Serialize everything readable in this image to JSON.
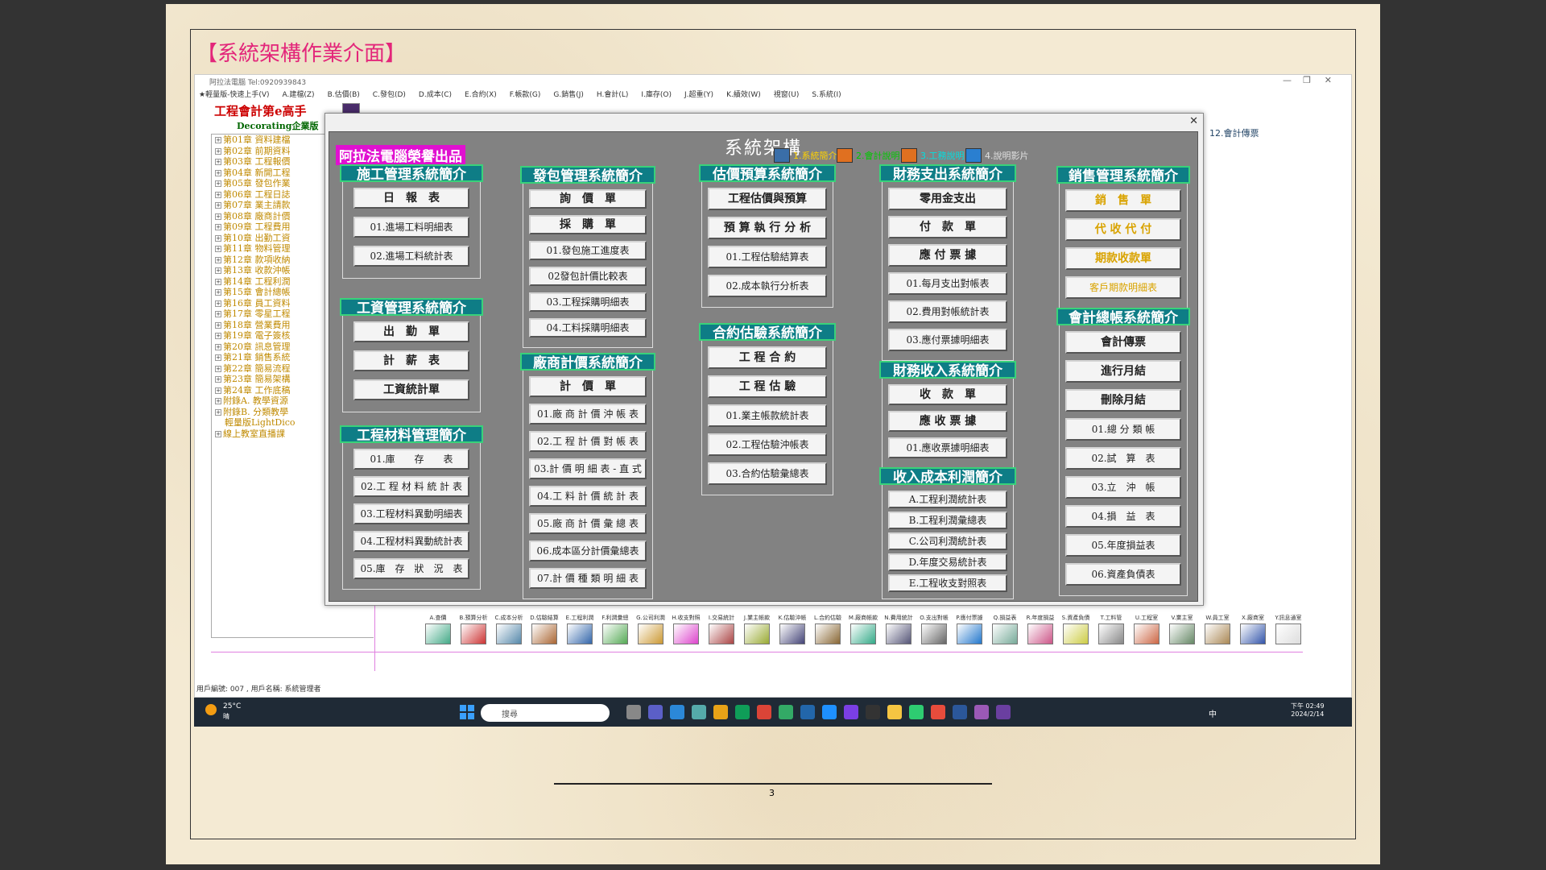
{
  "doc_title": "【系統架構作業介面】",
  "page_number": "3",
  "window": {
    "title": "阿拉法電腦 Tel:0920939843"
  },
  "menu": [
    "★輕量版-快速上手(V)",
    "A.建檔(Z)",
    "B.估價(B)",
    "C.發包(D)",
    "D.成本(C)",
    "E.合約(X)",
    "F.帳款(G)",
    "G.銷售(J)",
    "H.會計(L)",
    "I.庫存(O)",
    "J.超重(Y)",
    "K.績效(W)",
    "視窗(U)",
    "S.系統(I)"
  ],
  "brand": {
    "line1": "工程會計第e高手",
    "line2": "Decorating企業版"
  },
  "right_label": "12.會計傳票",
  "tree": [
    "第01章 資料建檔",
    "第02章 前期資料",
    "第03章 工程報價",
    "第04章 新開工程",
    "第05章 發包作業",
    "第06章 工程日誌",
    "第07章 業主請款",
    "第08章 廠商計價",
    "第09章 工程費用",
    "第10章 出勤工資",
    "第11章 物料管理",
    "第12章 款項收納",
    "第13章 收款沖帳",
    "第14章 工程利潤",
    "第15章 會計總帳",
    "第16章 員工資料",
    "第17章 零星工程",
    "第18章 營業費用",
    "第19章 電子簽核",
    "第20章 訊息管理",
    "第21章 銷售系統",
    "第22章 簡易流程",
    "第23章 簡易架構",
    "第24章 工作底稿",
    "附錄A. 教學資源",
    "附錄B. 分類教學",
    "輕量版LightDico",
    "線上教室直播課"
  ],
  "status": "用戶編號: 007 , 用戶名稱: 系統管理者",
  "dialog": {
    "title": "系統架構",
    "credit": "阿拉法電腦榮譽出品",
    "links": [
      {
        "label": "1.系統簡介",
        "color": "#ffd200"
      },
      {
        "label": "2.會計說明",
        "color": "#00c800"
      },
      {
        "label": "3.工務說明",
        "color": "#00e0e0"
      },
      {
        "label": "4.說明影片",
        "color": "#e0e0e0"
      }
    ],
    "groups": [
      {
        "title": "施工管理系統簡介",
        "buttons": [
          "日　報　表",
          "01.進場工料明細表",
          "02.進場工料統計表"
        ]
      },
      {
        "title": "工資管理系統簡介",
        "buttons": [
          "出　勤　單",
          "計　薪　表",
          "工資統計單"
        ]
      },
      {
        "title": "工程材料管理簡介",
        "buttons": [
          "01.庫　　存　　表",
          "02.工 程 材 料 統 計 表",
          "03.工程材料異動明細表",
          "04.工程材料異動統計表",
          "05.庫　存　狀　況　表"
        ]
      },
      {
        "title": "發包管理系統簡介",
        "buttons": [
          "詢　價　單",
          "採　購　單",
          "01.發包施工進度表",
          "02發包計價比較表",
          "03.工程採購明細表",
          "04.工料採購明細表"
        ]
      },
      {
        "title": "廠商計價系統簡介",
        "buttons": [
          "計　價　單",
          "01.廠 商 計 價 沖 帳 表",
          "02.工 程 計 價 對 帳 表",
          "03.計 價 明 細 表 - 直 式",
          "04.工 料 計 價 統 計 表",
          "05.廠 商 計 價 彙 總 表",
          "06.成本區分計價彙總表",
          "07.計 價 種 類 明 細 表"
        ]
      },
      {
        "title": "估價預算系統簡介",
        "buttons": [
          "工程估價與預算",
          "預 算 執 行 分 析",
          "01.工程估驗結算表",
          "02.成本執行分析表"
        ]
      },
      {
        "title": "合約估驗系統簡介",
        "buttons": [
          "工 程 合 約",
          "工 程 估 驗",
          "01.業主帳款統計表",
          "02.工程估驗沖帳表",
          "03.合約估驗彙總表"
        ]
      },
      {
        "title": "財務支出系統簡介",
        "buttons": [
          "零用金支出",
          "付　款　單",
          "應 付 票 據",
          "01.每月支出對帳表",
          "02.費用對帳統計表",
          "03.應付票據明細表"
        ]
      },
      {
        "title": "財務收入系統簡介",
        "buttons": [
          "收　款　單",
          "應 收 票 據",
          "01.應收票據明細表"
        ]
      },
      {
        "title": "收入成本利潤簡介",
        "buttons": [
          "A.工程利潤統計表",
          "B.工程利潤彙總表",
          "C.公司利潤統計表",
          "D.年度交易統計表",
          "E.工程收支對照表"
        ]
      },
      {
        "title": "銷售管理系統簡介",
        "buttons": [
          "銷　售　單",
          "代 收 代 付",
          "期款收款單",
          "客戶期款明細表"
        ]
      },
      {
        "title": "會計總帳系統簡介",
        "buttons": [
          "會計傳票",
          "進行月結",
          "刪除月結",
          "01.總 分 類 帳",
          "02.試　算　表",
          "03.立　沖　帳",
          "04.損　益　表",
          "05.年度損益表",
          "06.資產負債表"
        ]
      }
    ]
  },
  "toolbar": [
    "A.查價",
    "B.預算分析",
    "C.成本分析",
    "D.估驗結算",
    "E.工程利潤",
    "F.利潤彙總",
    "G.公司利潤",
    "H.收支對照",
    "I.交易統計",
    "J.業主帳款",
    "K.估驗沖帳",
    "L.合約估驗",
    "M.廠商帳款",
    "N.費用統計",
    "O.支出對帳",
    "P.應付票據",
    "Q.損益表",
    "R.年度損益",
    "S.資產負債",
    "T.工料管",
    "U.工程室",
    "V.業主室",
    "W.員工室",
    "X.廠商室",
    "Y.訊息通室"
  ],
  "taskbar": {
    "weather_temp": "25°C",
    "weather_desc": "晴",
    "search_placeholder": "搜尋",
    "ime": "中",
    "time": "下午 02:49",
    "date": "2024/2/14"
  }
}
